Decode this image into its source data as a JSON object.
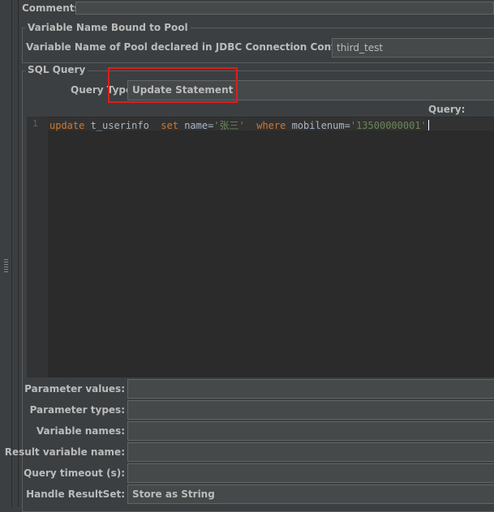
{
  "comments": {
    "label": "Comments:"
  },
  "variable_name_bound": {
    "legend": "Variable Name Bound to Pool",
    "pool_label": "Variable Name of Pool declared in JDBC Connection Configuration:",
    "pool_value": "third_test"
  },
  "sql_query": {
    "legend": "SQL Query",
    "query_type_label": "Query Type:",
    "query_type_value": "Update Statement",
    "query_label": "Query:",
    "line_number": "1",
    "code_tokens": [
      {
        "text": "update",
        "style": "kw"
      },
      {
        "text": " t_userinfo  ",
        "style": "id"
      },
      {
        "text": "set",
        "style": "kw"
      },
      {
        "text": " name=",
        "style": "id"
      },
      {
        "text": "'张三'",
        "style": "str"
      },
      {
        "text": "  ",
        "style": "id"
      },
      {
        "text": "where",
        "style": "kw"
      },
      {
        "text": " mobilenum=",
        "style": "id"
      },
      {
        "text": "'13500000001'",
        "style": "str"
      }
    ]
  },
  "params": [
    {
      "label": "Parameter values:",
      "value": ""
    },
    {
      "label": "Parameter types:",
      "value": ""
    },
    {
      "label": "Variable names:",
      "value": ""
    },
    {
      "label": "Result variable name:",
      "value": ""
    },
    {
      "label": "Query timeout (s):",
      "value": ""
    },
    {
      "label": "Handle ResultSet:",
      "value": "Store as String"
    }
  ],
  "colors": {
    "highlight_box": "#e01c1c",
    "background": "#3c3f41",
    "editor_bg": "#2b2b2b"
  }
}
